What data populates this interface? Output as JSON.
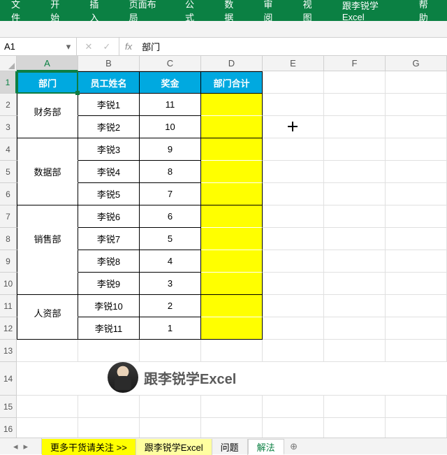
{
  "ribbon": {
    "tabs": [
      "文件",
      "开始",
      "插入",
      "页面布局",
      "公式",
      "数据",
      "审阅",
      "视图",
      "跟李锐学Excel",
      "帮助"
    ]
  },
  "namebox": {
    "value": "A1"
  },
  "formula_bar": {
    "fx_label": "fx",
    "value": "部门"
  },
  "columns": [
    "A",
    "B",
    "C",
    "D",
    "E",
    "F",
    "G"
  ],
  "header_row": {
    "dept": "部门",
    "name": "员工姓名",
    "bonus": "奖金",
    "total": "部门合计"
  },
  "depts": {
    "finance": "财务部",
    "data": "数据部",
    "sales": "销售部",
    "hr": "人资部"
  },
  "rows": [
    {
      "name": "李锐1",
      "bonus": "11"
    },
    {
      "name": "李锐2",
      "bonus": "10"
    },
    {
      "name": "李锐3",
      "bonus": "9"
    },
    {
      "name": "李锐4",
      "bonus": "8"
    },
    {
      "name": "李锐5",
      "bonus": "7"
    },
    {
      "name": "李锐6",
      "bonus": "6"
    },
    {
      "name": "李锐7",
      "bonus": "5"
    },
    {
      "name": "李锐8",
      "bonus": "4"
    },
    {
      "name": "李锐9",
      "bonus": "3"
    },
    {
      "name": "李锐10",
      "bonus": "2"
    },
    {
      "name": "李锐11",
      "bonus": "1"
    }
  ],
  "row_numbers": [
    "1",
    "2",
    "3",
    "4",
    "5",
    "6",
    "7",
    "8",
    "9",
    "10",
    "11",
    "12",
    "13",
    "14",
    "15",
    "16"
  ],
  "brand_text": "跟李锐学Excel",
  "sheet_tabs": {
    "more": "更多干货请关注 >>",
    "main": "跟李锐学Excel",
    "problem": "问题",
    "solution": "解法"
  }
}
